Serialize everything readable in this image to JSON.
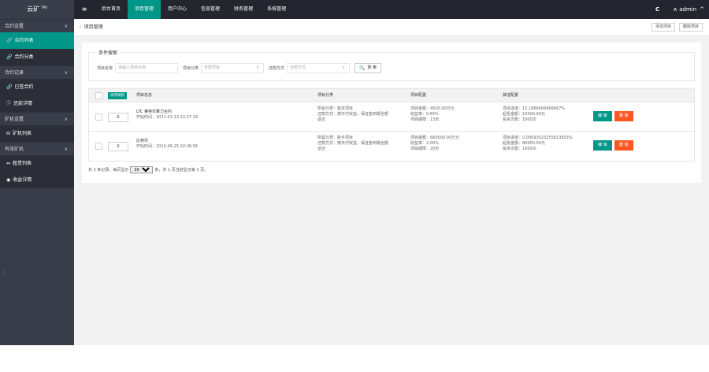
{
  "logo": {
    "text": "云矿",
    "sup": "TP6"
  },
  "topnav": {
    "items": [
      "后台首页",
      "项目管理",
      "用户中心",
      "信息管理",
      "财务管理",
      "系统管理"
    ],
    "user": "admin"
  },
  "sidebar": {
    "groups": [
      {
        "label": "合约设置",
        "items": [
          "合约列表",
          "合约分类"
        ]
      },
      {
        "label": "合约记录",
        "items": [
          "已签合约",
          "还款详情"
        ]
      },
      {
        "label": "矿机设置",
        "items": [
          "矿机列表"
        ]
      },
      {
        "label": "有效矿机",
        "items": [
          "租赁列表",
          "收益详情"
        ]
      }
    ]
  },
  "breadcrumb": "项目管理",
  "tab_buttons": {
    "add": "添加项目",
    "delete": "删除项目"
  },
  "search": {
    "legend": "条件搜索",
    "name_label": "项目名称",
    "name_placeholder": "请输入项目名称",
    "category_label": "项目分类",
    "category_value": "全部项目",
    "repay_label": "还款方式",
    "repay_value": "全部方式",
    "button": "搜 索"
  },
  "table": {
    "sort_button": "排序刷新",
    "headers": {
      "info": "项目信息",
      "category": "项目分类",
      "config": "项目配置",
      "other": "其他配置"
    },
    "rows": [
      {
        "sort": "0",
        "name": "LTC 莱特币算力合约",
        "start": "开始时间：2021-01-13 22:27:19",
        "cat1": "所属分类：稳定项目",
        "cat2": "还款方式：按日付收益，保证金到期全额",
        "cat3": "返还",
        "cfg1": "项目金额：4500.00万元",
        "cfg2": "收益率：0.65%",
        "cfg3": "项目期限：13天",
        "oth1": "项目进度：12.1866666666667%",
        "oth2": "起投金额：10500.00元",
        "oth3": "投资次数：1000次",
        "edit": "编 辑",
        "del": "删 除"
      },
      {
        "sort": "0",
        "name": "比特币",
        "start": "开始时间：2013-06-25 02:36:56",
        "cat1": "所属分类：新手项目",
        "cat2": "还款方式：按日付收益，保证金到期全额",
        "cat3": "返还",
        "cfg1": "项目金额：660000.00万元",
        "cfg2": "收益率：2.00%",
        "cfg3": "项目期限：20天",
        "oth1": "项目进度：0.00093023255813953%",
        "oth2": "起投金额：80000.00元",
        "oth3": "投资次数：1000次",
        "edit": "编 辑",
        "del": "删 除"
      }
    ]
  },
  "pager": {
    "pre": "共 2 条记录，每页显示",
    "size": "20",
    "post": "条，共 1 页当前显示第 1 页。"
  },
  "icons": {
    "menu": "hamburger-icon",
    "refresh": "refresh-icon",
    "user": "user-icon",
    "search": "search-icon"
  },
  "colors": {
    "accent": "#009688",
    "danger": "#ff5722",
    "sidebar": "#393d49",
    "topbar": "#23262e"
  }
}
